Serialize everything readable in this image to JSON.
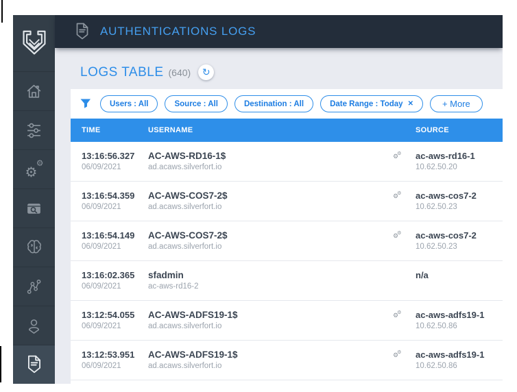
{
  "header": {
    "title": "AUTHENTICATIONS LOGS"
  },
  "sidebar": {
    "logo_icon": "silverfort-shield-logo",
    "items": [
      {
        "icon": "home-icon",
        "active": false
      },
      {
        "icon": "sliders-icon",
        "active": false
      },
      {
        "icon": "gears-icon",
        "active": false
      },
      {
        "icon": "browser-search-icon",
        "active": false
      },
      {
        "icon": "brain-icon",
        "active": false
      },
      {
        "icon": "network-nodes-icon",
        "active": false
      },
      {
        "icon": "user-icon",
        "active": false
      },
      {
        "icon": "logs-document-icon",
        "active": true
      }
    ]
  },
  "logs_table": {
    "title": "LOGS TABLE",
    "count": "(640)",
    "refresh_icon": "↻",
    "filters": {
      "funnel_icon": "filter-funnel-icon",
      "chips": [
        {
          "label": "Users : All",
          "removable": false
        },
        {
          "label": "Source : All",
          "removable": false
        },
        {
          "label": "Destination : All",
          "removable": false
        },
        {
          "label": "Date Range : Today",
          "removable": true
        }
      ],
      "remove_icon": "✕",
      "more_label": "+ More"
    },
    "columns": [
      "TIME",
      "USERNAME",
      "SOURCE"
    ],
    "row_icon": "service-account-gears-icon",
    "rows": [
      {
        "time": "13:16:56.327",
        "date": "06/09/2021",
        "username": "AC-AWS-RD16-1$",
        "domain": "ad.acaws.silverfort.io",
        "has_icon": true,
        "source": "ac-aws-rd16-1",
        "ip": "10.62.50.20"
      },
      {
        "time": "13:16:54.359",
        "date": "06/09/2021",
        "username": "AC-AWS-COS7-2$",
        "domain": "ad.acaws.silverfort.io",
        "has_icon": true,
        "source": "ac-aws-cos7-2",
        "ip": "10.62.50.23"
      },
      {
        "time": "13:16:54.149",
        "date": "06/09/2021",
        "username": "AC-AWS-COS7-2$",
        "domain": "ad.acaws.silverfort.io",
        "has_icon": true,
        "source": "ac-aws-cos7-2",
        "ip": "10.62.50.23"
      },
      {
        "time": "13:16:02.365",
        "date": "06/09/2021",
        "username": "sfadmin",
        "domain": "ac-aws-rd16-2",
        "has_icon": false,
        "source": "n/a",
        "ip": ""
      },
      {
        "time": "13:12:54.055",
        "date": "06/09/2021",
        "username": "AC-AWS-ADFS19-1$",
        "domain": "ad.acaws.silverfort.io",
        "has_icon": true,
        "source": "ac-aws-adfs19-1",
        "ip": "10.62.50.86"
      },
      {
        "time": "13:12:53.951",
        "date": "06/09/2021",
        "username": "AC-AWS-ADFS19-1$",
        "domain": "ad.acaws.silverfort.io",
        "has_icon": true,
        "source": "ac-aws-adfs19-1",
        "ip": "10.62.50.86"
      }
    ]
  },
  "colors": {
    "accent_blue": "#2d8de8",
    "table_header_bg": "#2e8fe9",
    "topbar_bg": "#232d3a",
    "sidebar_bg": "#333e48",
    "sidebar_active_bg": "#3e4b57",
    "content_bg": "#e9ebf1"
  }
}
